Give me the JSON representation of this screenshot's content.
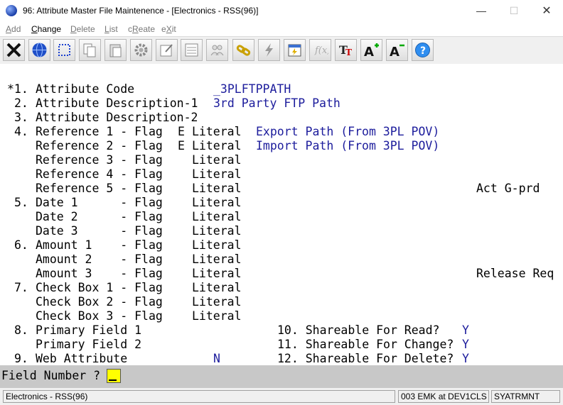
{
  "window": {
    "title": "96: Attribute Master File Maintenence - [Electronics - RSS(96)]"
  },
  "menu": [
    {
      "label": "Add",
      "accel": "A"
    },
    {
      "label": "Change",
      "accel": "C"
    },
    {
      "label": "Delete",
      "accel": "D"
    },
    {
      "label": "List",
      "accel": "L"
    },
    {
      "label": "cReate",
      "accel": "R"
    },
    {
      "label": "eXit",
      "accel": "X"
    }
  ],
  "toolbar": {
    "icons": [
      "exit-icon",
      "globe-icon",
      "select-icon",
      "copy-icon",
      "paste-icon",
      "settings-icon",
      "edit-form-icon",
      "list-icon",
      "users-icon",
      "link-icon",
      "lightning-icon",
      "calendar-icon",
      "script-icon",
      "text-size-icon",
      "font-larger-icon",
      "font-smaller-icon",
      "help-icon"
    ]
  },
  "colors": {
    "accent_blue": "#1c1c9c",
    "command_bar": "#c8c8c8",
    "input_highlight": "#ffff00"
  },
  "screen": {
    "r1_num": "*1.",
    "r1_label": "Attribute Code",
    "r1_value": "_3PLFTPPATH",
    "r2_num": "2.",
    "r2_label": "Attribute Description-1",
    "r2_value": "3rd Party FTP Path",
    "r3_num": "3.",
    "r3_label": "Attribute Description-2",
    "r4_num": "4.",
    "r4_label": "Reference 1 - Flag",
    "r4_flag": "E",
    "r4_lit": "Literal",
    "r4_value": "Export Path (From 3PL POV)",
    "r5_label": "Reference 2 - Flag",
    "r5_flag": "E",
    "r5_lit": "Literal",
    "r5_value": "Import Path (From 3PL POV)",
    "r6_label": "Reference 3 - Flag",
    "r6_lit": "Literal",
    "r7_label": "Reference 4 - Flag",
    "r7_lit": "Literal",
    "r8_label": "Reference 5 - Flag",
    "r8_lit": "Literal",
    "r8_right": "Act G-prd",
    "r9_num": "5.",
    "r9_label": "Date 1      - Flag",
    "r9_lit": "Literal",
    "r10_label": "Date 2      - Flag",
    "r10_lit": "Literal",
    "r11_label": "Date 3      - Flag",
    "r11_lit": "Literal",
    "r12_num": "6.",
    "r12_label": "Amount 1    - Flag",
    "r12_lit": "Literal",
    "r13_label": "Amount 2    - Flag",
    "r13_lit": "Literal",
    "r14_label": "Amount 3    - Flag",
    "r14_lit": "Literal",
    "r14_right": "Release Req",
    "r15_num": "7.",
    "r15_label": "Check Box 1 - Flag",
    "r15_lit": "Literal",
    "r16_label": "Check Box 2 - Flag",
    "r16_lit": "Literal",
    "r17_label": "Check Box 3 - Flag",
    "r17_lit": "Literal",
    "r18_num": "8.",
    "r18_label": "Primary Field 1",
    "r18_rlabel": "10. Shareable For Read?",
    "r18_rvalue": "Y",
    "r19_label": "Primary Field 2",
    "r19_rlabel": "11. Shareable For Change?",
    "r19_rvalue": "Y",
    "r20_num": "9.",
    "r20_label": "Web Attribute",
    "r20_value": "N",
    "r20_rlabel": "12. Shareable For Delete?",
    "r20_rvalue": "Y"
  },
  "command": {
    "prompt": "Field Number ?",
    "value": ""
  },
  "status": {
    "company": "Electronics - RSS(96)",
    "session": "003 EMK at DEV1CLS",
    "program": "SYATRMNT"
  }
}
